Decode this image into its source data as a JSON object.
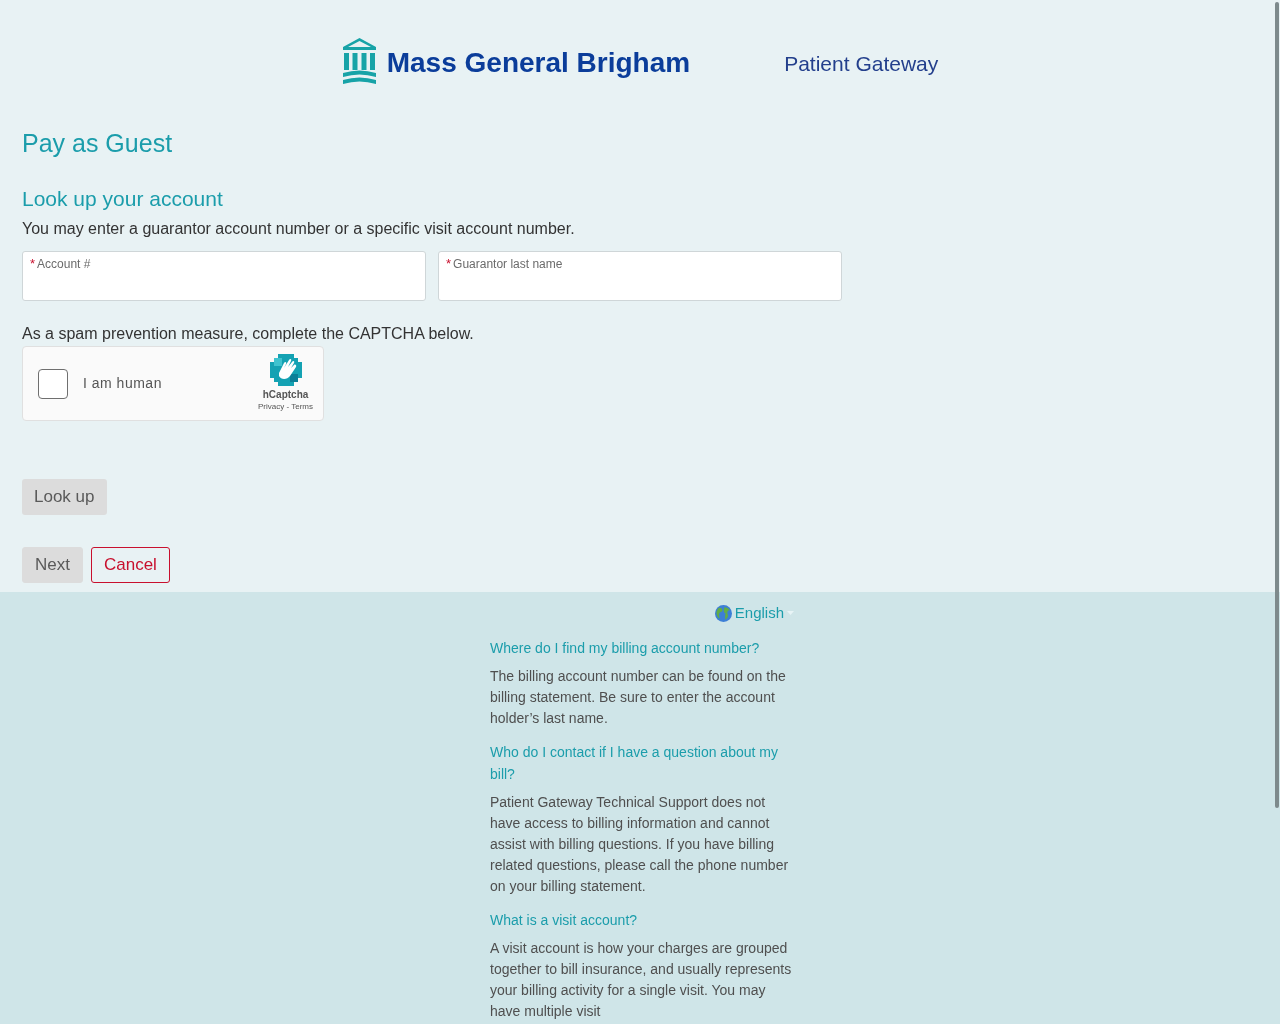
{
  "header": {
    "logo_text": "Mass General Brigham",
    "app_name": "Patient Gateway"
  },
  "page": {
    "title": "Pay as Guest",
    "section_title": "Look up your account",
    "instructions": "You may enter a guarantor account number or a specific visit account number."
  },
  "form": {
    "required_mark": "*",
    "fields": [
      {
        "label": "Account #",
        "required": true
      },
      {
        "label": "Guarantor last name",
        "required": true
      }
    ]
  },
  "captcha": {
    "prompt": "As a spam prevention measure, complete the CAPTCHA below.",
    "label": "I am human",
    "checked": false,
    "brand": "hCaptcha",
    "links": "Privacy - Terms"
  },
  "lookup_button": {
    "label": "Look up"
  },
  "actions": [
    {
      "label": "Next",
      "kind": "neutral"
    },
    {
      "label": "Cancel",
      "kind": "cancel"
    }
  ],
  "footer": {
    "language": "English",
    "faq": [
      {
        "question": "Where do I find my billing account number?",
        "answer": "The billing account number can be found on the billing statement. Be sure to enter the account holder’s last name."
      },
      {
        "question": "Who do I contact if I have a question about my bill?",
        "answer": "Patient Gateway Technical Support does not have access to billing information and cannot assist with billing questions. If you have billing related questions, please call the phone number on your billing statement."
      },
      {
        "question": "What is a visit account?",
        "answer": "A visit account is how your charges are grouped together to bill insurance, and usually represents your billing activity for a single visit. You may have multiple visit"
      }
    ]
  }
}
